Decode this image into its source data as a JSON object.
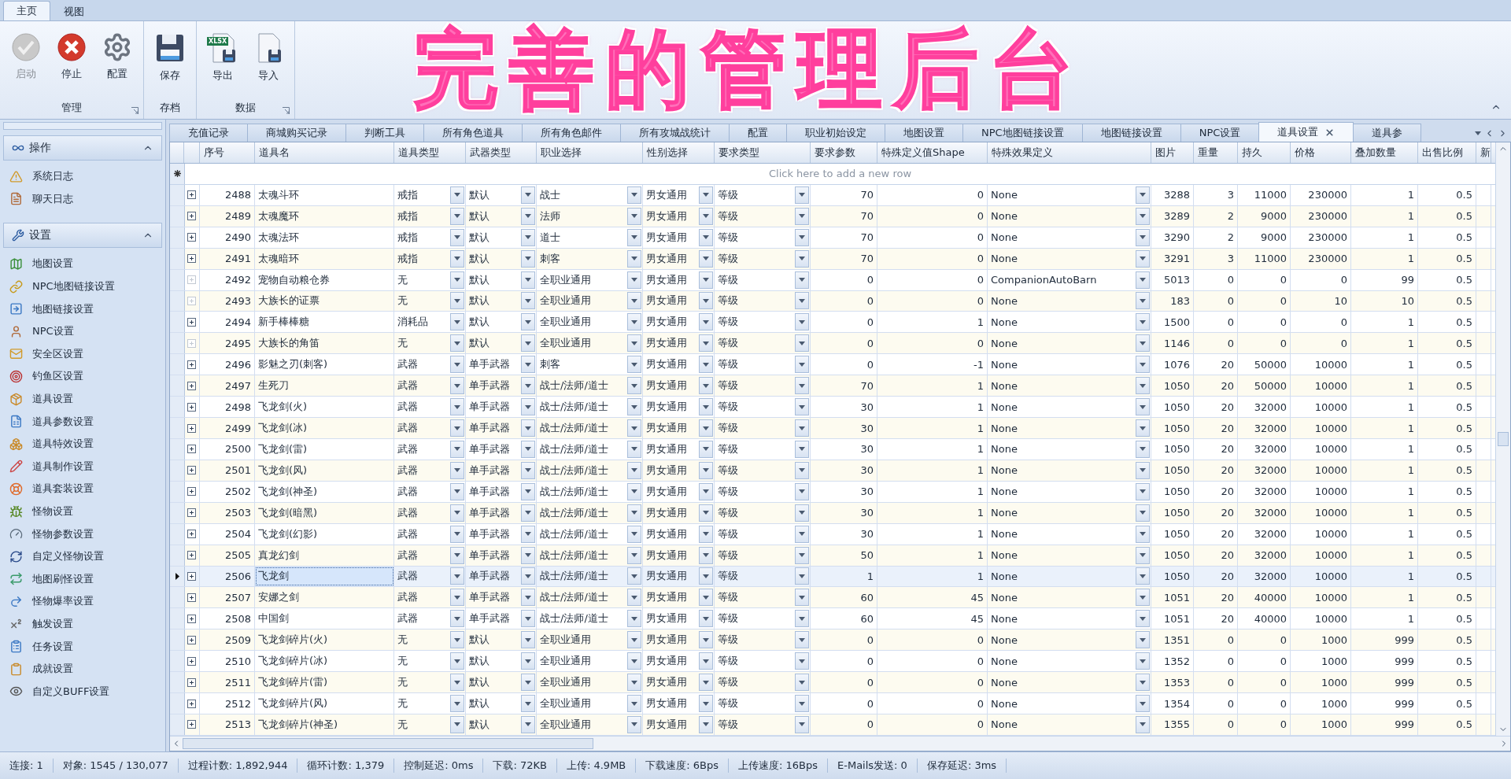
{
  "ribbon": {
    "tabs": [
      {
        "label": "主页",
        "selected": true
      },
      {
        "label": "视图",
        "selected": false
      }
    ],
    "groups": [
      {
        "label": "管理",
        "launcher": true,
        "buttons": [
          {
            "label": "启动",
            "kind": "start",
            "disabled": true
          },
          {
            "label": "停止",
            "kind": "stop",
            "disabled": false
          },
          {
            "label": "配置",
            "kind": "gear",
            "disabled": false
          }
        ]
      },
      {
        "label": "存档",
        "launcher": false,
        "buttons": [
          {
            "label": "保存",
            "kind": "save",
            "disabled": false
          }
        ]
      },
      {
        "label": "数据",
        "launcher": true,
        "buttons": [
          {
            "label": "导出",
            "kind": "export",
            "badge": "XLSX",
            "disabled": false
          },
          {
            "label": "导入",
            "kind": "import",
            "disabled": false
          }
        ]
      }
    ],
    "headline": "完善的管理后台"
  },
  "sidebar": {
    "groups": [
      {
        "title": "操作",
        "kind": "ops",
        "expanded": true,
        "items": [
          "系统日志",
          "聊天日志"
        ]
      },
      {
        "title": "设置",
        "kind": "settings",
        "expanded": true,
        "items": [
          "地图设置",
          "NPC地图链接设置",
          "地图链接设置",
          "NPC设置",
          "安全区设置",
          "钓鱼区设置",
          "道具设置",
          "道具参数设置",
          "道具特效设置",
          "道具制作设置",
          "道具套装设置",
          "怪物设置",
          "怪物参数设置",
          "自定义怪物设置",
          "地图刷怪设置",
          "怪物爆率设置",
          "触发设置",
          "任务设置",
          "成就设置",
          "自定义BUFF设置"
        ]
      }
    ]
  },
  "doc_tabs": [
    {
      "label": "充值记录",
      "selected": false
    },
    {
      "label": "商城购买记录",
      "selected": false
    },
    {
      "label": "判断工具",
      "selected": false
    },
    {
      "label": "所有角色道具",
      "selected": false
    },
    {
      "label": "所有角色邮件",
      "selected": false
    },
    {
      "label": "所有攻城战统计",
      "selected": false
    },
    {
      "label": "配置",
      "selected": false
    },
    {
      "label": "职业初始设定",
      "selected": false
    },
    {
      "label": "地图设置",
      "selected": false
    },
    {
      "label": "NPC地图链接设置",
      "selected": false
    },
    {
      "label": "地图链接设置",
      "selected": false
    },
    {
      "label": "NPC设置",
      "selected": false
    },
    {
      "label": "道具设置",
      "selected": true
    },
    {
      "label": "道具参",
      "selected": false
    }
  ],
  "table": {
    "new_row_hint": "Click here to add a new row",
    "columns": [
      {
        "label": "序号",
        "kind": "number"
      },
      {
        "label": "道具名",
        "kind": "text"
      },
      {
        "label": "道具类型",
        "kind": "dropdown"
      },
      {
        "label": "武器类型",
        "kind": "dropdown"
      },
      {
        "label": "职业选择",
        "kind": "dropdown"
      },
      {
        "label": "性别选择",
        "kind": "dropdown"
      },
      {
        "label": "要求类型",
        "kind": "dropdown"
      },
      {
        "label": "要求参数",
        "kind": "number"
      },
      {
        "label": "特殊定义值Shape",
        "kind": "number"
      },
      {
        "label": "特殊效果定义",
        "kind": "dropdown"
      },
      {
        "label": "图片",
        "kind": "number"
      },
      {
        "label": "重量",
        "kind": "number"
      },
      {
        "label": "持久",
        "kind": "number"
      },
      {
        "label": "价格",
        "kind": "number"
      },
      {
        "label": "叠加数量",
        "kind": "number"
      },
      {
        "label": "出售比例",
        "kind": "number"
      },
      {
        "label": "新",
        "kind": "number"
      }
    ],
    "rows": [
      {
        "selected": false,
        "expandable": true,
        "cells": [
          "2488",
          "太魂斗环",
          "戒指",
          "默认",
          "战士",
          "男女通用",
          "等级",
          "70",
          "0",
          "None",
          "3288",
          "3",
          "11000",
          "230000",
          "1",
          "0.5"
        ]
      },
      {
        "selected": false,
        "expandable": true,
        "cells": [
          "2489",
          "太魂魔环",
          "戒指",
          "默认",
          "法师",
          "男女通用",
          "等级",
          "70",
          "0",
          "None",
          "3289",
          "2",
          "9000",
          "230000",
          "1",
          "0.5"
        ]
      },
      {
        "selected": false,
        "expandable": true,
        "cells": [
          "2490",
          "太魂法环",
          "戒指",
          "默认",
          "道士",
          "男女通用",
          "等级",
          "70",
          "0",
          "None",
          "3290",
          "2",
          "9000",
          "230000",
          "1",
          "0.5"
        ]
      },
      {
        "selected": false,
        "expandable": true,
        "cells": [
          "2491",
          "太魂暗环",
          "戒指",
          "默认",
          "刺客",
          "男女通用",
          "等级",
          "70",
          "0",
          "None",
          "3291",
          "3",
          "11000",
          "230000",
          "1",
          "0.5"
        ]
      },
      {
        "selected": false,
        "expandable": false,
        "cells": [
          "2492",
          "宠物自动粮仓券",
          "无",
          "默认",
          "全职业通用",
          "男女通用",
          "等级",
          "0",
          "0",
          "CompanionAutoBarn",
          "5013",
          "0",
          "0",
          "0",
          "99",
          "0.5"
        ]
      },
      {
        "selected": false,
        "expandable": false,
        "cells": [
          "2493",
          "大族长的证票",
          "无",
          "默认",
          "全职业通用",
          "男女通用",
          "等级",
          "0",
          "0",
          "None",
          "183",
          "0",
          "0",
          "10",
          "10",
          "0.5"
        ]
      },
      {
        "selected": false,
        "expandable": true,
        "cells": [
          "2494",
          "新手棒棒糖",
          "消耗品",
          "默认",
          "全职业通用",
          "男女通用",
          "等级",
          "0",
          "1",
          "None",
          "1500",
          "0",
          "0",
          "0",
          "1",
          "0.5"
        ]
      },
      {
        "selected": false,
        "expandable": false,
        "cells": [
          "2495",
          "大族长的角笛",
          "无",
          "默认",
          "全职业通用",
          "男女通用",
          "等级",
          "0",
          "0",
          "None",
          "1146",
          "0",
          "0",
          "0",
          "1",
          "0.5"
        ]
      },
      {
        "selected": false,
        "expandable": true,
        "cells": [
          "2496",
          "影魅之刃(刺客)",
          "武器",
          "单手武器",
          "刺客",
          "男女通用",
          "等级",
          "0",
          "-1",
          "None",
          "1076",
          "20",
          "50000",
          "10000",
          "1",
          "0.5"
        ]
      },
      {
        "selected": false,
        "expandable": true,
        "cells": [
          "2497",
          "生死刀",
          "武器",
          "单手武器",
          "战士/法师/道士",
          "男女通用",
          "等级",
          "70",
          "1",
          "None",
          "1050",
          "20",
          "50000",
          "10000",
          "1",
          "0.5"
        ]
      },
      {
        "selected": false,
        "expandable": true,
        "cells": [
          "2498",
          "飞龙剑(火)",
          "武器",
          "单手武器",
          "战士/法师/道士",
          "男女通用",
          "等级",
          "30",
          "1",
          "None",
          "1050",
          "20",
          "32000",
          "10000",
          "1",
          "0.5"
        ]
      },
      {
        "selected": false,
        "expandable": true,
        "cells": [
          "2499",
          "飞龙剑(冰)",
          "武器",
          "单手武器",
          "战士/法师/道士",
          "男女通用",
          "等级",
          "30",
          "1",
          "None",
          "1050",
          "20",
          "32000",
          "10000",
          "1",
          "0.5"
        ]
      },
      {
        "selected": false,
        "expandable": true,
        "cells": [
          "2500",
          "飞龙剑(雷)",
          "武器",
          "单手武器",
          "战士/法师/道士",
          "男女通用",
          "等级",
          "30",
          "1",
          "None",
          "1050",
          "20",
          "32000",
          "10000",
          "1",
          "0.5"
        ]
      },
      {
        "selected": false,
        "expandable": true,
        "cells": [
          "2501",
          "飞龙剑(风)",
          "武器",
          "单手武器",
          "战士/法师/道士",
          "男女通用",
          "等级",
          "30",
          "1",
          "None",
          "1050",
          "20",
          "32000",
          "10000",
          "1",
          "0.5"
        ]
      },
      {
        "selected": false,
        "expandable": true,
        "cells": [
          "2502",
          "飞龙剑(神圣)",
          "武器",
          "单手武器",
          "战士/法师/道士",
          "男女通用",
          "等级",
          "30",
          "1",
          "None",
          "1050",
          "20",
          "32000",
          "10000",
          "1",
          "0.5"
        ]
      },
      {
        "selected": false,
        "expandable": true,
        "cells": [
          "2503",
          "飞龙剑(暗黑)",
          "武器",
          "单手武器",
          "战士/法师/道士",
          "男女通用",
          "等级",
          "30",
          "1",
          "None",
          "1050",
          "20",
          "32000",
          "10000",
          "1",
          "0.5"
        ]
      },
      {
        "selected": false,
        "expandable": true,
        "cells": [
          "2504",
          "飞龙剑(幻影)",
          "武器",
          "单手武器",
          "战士/法师/道士",
          "男女通用",
          "等级",
          "30",
          "1",
          "None",
          "1050",
          "20",
          "32000",
          "10000",
          "1",
          "0.5"
        ]
      },
      {
        "selected": false,
        "expandable": true,
        "cells": [
          "2505",
          "真龙幻剑",
          "武器",
          "单手武器",
          "战士/法师/道士",
          "男女通用",
          "等级",
          "50",
          "1",
          "None",
          "1050",
          "20",
          "32000",
          "10000",
          "1",
          "0.5"
        ]
      },
      {
        "selected": true,
        "expandable": true,
        "cells": [
          "2506",
          "飞龙剑",
          "武器",
          "单手武器",
          "战士/法师/道士",
          "男女通用",
          "等级",
          "1",
          "1",
          "None",
          "1050",
          "20",
          "32000",
          "10000",
          "1",
          "0.5"
        ]
      },
      {
        "selected": false,
        "expandable": true,
        "cells": [
          "2507",
          "安娜之剑",
          "武器",
          "单手武器",
          "战士/法师/道士",
          "男女通用",
          "等级",
          "60",
          "45",
          "None",
          "1051",
          "20",
          "40000",
          "10000",
          "1",
          "0.5"
        ]
      },
      {
        "selected": false,
        "expandable": true,
        "cells": [
          "2508",
          "中国剑",
          "武器",
          "单手武器",
          "战士/法师/道士",
          "男女通用",
          "等级",
          "60",
          "45",
          "None",
          "1051",
          "20",
          "40000",
          "10000",
          "1",
          "0.5"
        ]
      },
      {
        "selected": false,
        "expandable": true,
        "cells": [
          "2509",
          "飞龙剑碎片(火)",
          "无",
          "默认",
          "全职业通用",
          "男女通用",
          "等级",
          "0",
          "0",
          "None",
          "1351",
          "0",
          "0",
          "1000",
          "999",
          "0.5"
        ]
      },
      {
        "selected": false,
        "expandable": true,
        "cells": [
          "2510",
          "飞龙剑碎片(冰)",
          "无",
          "默认",
          "全职业通用",
          "男女通用",
          "等级",
          "0",
          "0",
          "None",
          "1352",
          "0",
          "0",
          "1000",
          "999",
          "0.5"
        ]
      },
      {
        "selected": false,
        "expandable": true,
        "cells": [
          "2511",
          "飞龙剑碎片(雷)",
          "无",
          "默认",
          "全职业通用",
          "男女通用",
          "等级",
          "0",
          "0",
          "None",
          "1353",
          "0",
          "0",
          "1000",
          "999",
          "0.5"
        ]
      },
      {
        "selected": false,
        "expandable": true,
        "cells": [
          "2512",
          "飞龙剑碎片(风)",
          "无",
          "默认",
          "全职业通用",
          "男女通用",
          "等级",
          "0",
          "0",
          "None",
          "1354",
          "0",
          "0",
          "1000",
          "999",
          "0.5"
        ]
      },
      {
        "selected": false,
        "expandable": true,
        "cells": [
          "2513",
          "飞龙剑碎片(神圣)",
          "无",
          "默认",
          "全职业通用",
          "男女通用",
          "等级",
          "0",
          "0",
          "None",
          "1355",
          "0",
          "0",
          "1000",
          "999",
          "0.5"
        ]
      }
    ]
  },
  "status_bar": [
    "连接: 1",
    "对象: 1545 / 130,077",
    "过程计数: 1,892,944",
    "循环计数: 1,379",
    "控制延迟: 0ms",
    "下载: 72KB",
    "上传: 4.9MB",
    "下载速度: 6Bps",
    "上传速度: 16Bps",
    "E-Mails发送: 0",
    "保存延迟: 3ms"
  ]
}
